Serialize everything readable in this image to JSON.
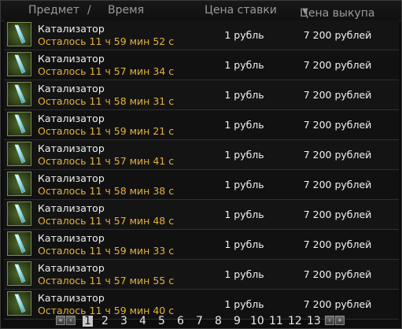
{
  "header": {
    "item_label": "Предмет",
    "separator": "/",
    "time_label": "Время",
    "bid_label": "Цена ставки",
    "buyout_label": "Цена выкупа",
    "sort_indicator": "▼"
  },
  "rows": [
    {
      "name": "Катализатор",
      "time": "Осталось 11 ч 59 мин 52 с",
      "bid": "1 рубль",
      "buyout": "7 200 рублей"
    },
    {
      "name": "Катализатор",
      "time": "Осталось 11 ч 57 мин 34 с",
      "bid": "1 рубль",
      "buyout": "7 200 рублей"
    },
    {
      "name": "Катализатор",
      "time": "Осталось 11 ч 58 мин 31 с",
      "bid": "1 рубль",
      "buyout": "7 200 рублей"
    },
    {
      "name": "Катализатор",
      "time": "Осталось 11 ч 59 мин 21 с",
      "bid": "1 рубль",
      "buyout": "7 200 рублей"
    },
    {
      "name": "Катализатор",
      "time": "Осталось 11 ч 57 мин 41 с",
      "bid": "1 рубль",
      "buyout": "7 200 рублей"
    },
    {
      "name": "Катализатор",
      "time": "Осталось 11 ч 58 мин 38 с",
      "bid": "1 рубль",
      "buyout": "7 200 рублей"
    },
    {
      "name": "Катализатор",
      "time": "Осталось 11 ч 57 мин 48 с",
      "bid": "1 рубль",
      "buyout": "7 200 рублей"
    },
    {
      "name": "Катализатор",
      "time": "Осталось 11 ч 59 мин 33 с",
      "bid": "1 рубль",
      "buyout": "7 200 рублей"
    },
    {
      "name": "Катализатор",
      "time": "Осталось 11 ч 57 мин 55 с",
      "bid": "1 рубль",
      "buyout": "7 200 рублей"
    },
    {
      "name": "Катализатор",
      "time": "Осталось 11 ч 59 мин 40 с",
      "bid": "1 рубль",
      "buyout": "7 200 рублей"
    }
  ],
  "pagination": {
    "pages": [
      "1",
      "2",
      "3",
      "4",
      "5",
      "6",
      "7",
      "8",
      "9",
      "10",
      "11",
      "12",
      "13"
    ],
    "current": "1",
    "first_icon": "double-arrow-left-icon",
    "prev_icon": "arrow-left-icon",
    "next_icon": "arrow-right-icon",
    "last_icon": "double-arrow-right-icon"
  },
  "item_icon": "catalyst-crystal-icon",
  "colors": {
    "time_text": "#e3b23c",
    "text": "#f2f2f2",
    "header_text": "#9a9a9a",
    "background": "#0d0d0d"
  }
}
